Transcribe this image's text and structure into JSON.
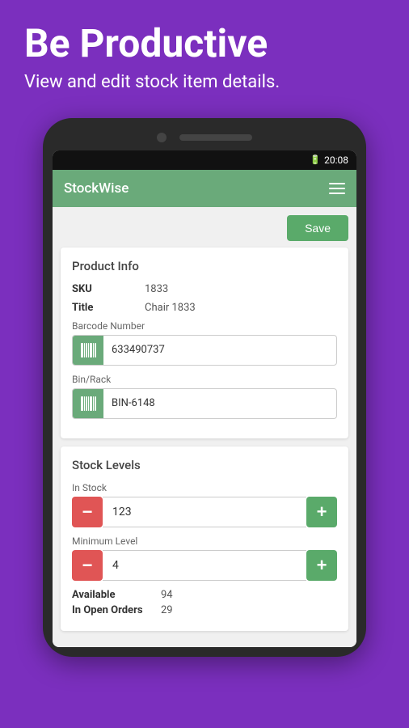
{
  "hero": {
    "title": "Be Productive",
    "subtitle": "View and edit stock item details."
  },
  "status_bar": {
    "battery": "🔋",
    "time": "20:08"
  },
  "app_bar": {
    "title": "StockWise",
    "menu_icon": "hamburger-menu"
  },
  "toolbar": {
    "save_label": "Save"
  },
  "product_info": {
    "card_title": "Product Info",
    "sku_label": "SKU",
    "sku_value": "1833",
    "title_label": "Title",
    "title_value": "Chair 1833",
    "barcode_label": "Barcode Number",
    "barcode_value": "633490737",
    "bin_label": "Bin/Rack",
    "bin_value": "BIN-6148"
  },
  "stock_levels": {
    "card_title": "Stock Levels",
    "in_stock_label": "In Stock",
    "in_stock_value": "123",
    "min_level_label": "Minimum Level",
    "min_level_value": "4",
    "available_label": "Available",
    "available_value": "94",
    "open_orders_label": "In Open Orders",
    "open_orders_value": "29"
  }
}
